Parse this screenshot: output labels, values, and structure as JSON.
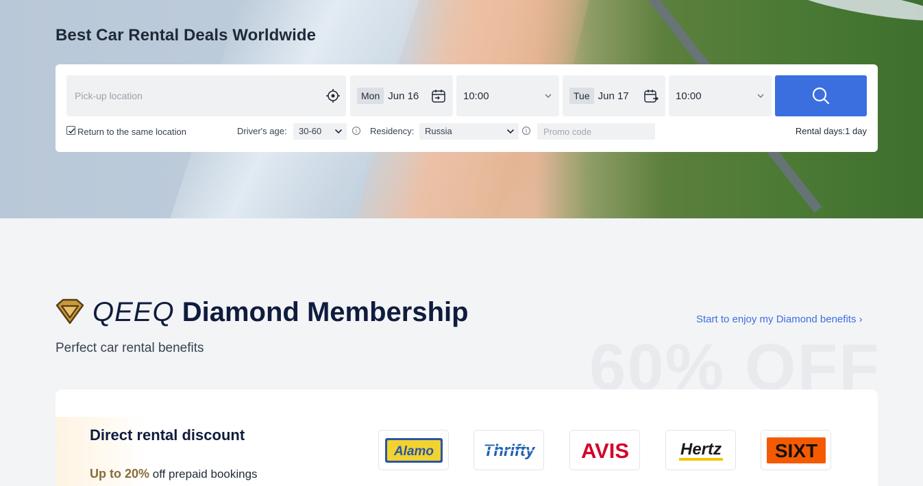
{
  "hero": {
    "title": "Best Car Rental Deals Worldwide"
  },
  "search": {
    "pickup_placeholder": "Pick-up location",
    "pickup_day": "Mon",
    "pickup_date": "Jun 16",
    "pickup_time": "10:00",
    "return_day": "Tue",
    "return_date": "Jun 17",
    "return_time": "10:00",
    "return_same_label": "Return to the same location",
    "return_same_checked": true,
    "age_label": "Driver's age:",
    "age_value": "30-60",
    "residency_label": "Residency:",
    "residency_value": "Russia",
    "promo_placeholder": "Promo code",
    "rental_days": "Rental days:1 day",
    "button_color": "#3b6fe0"
  },
  "membership": {
    "brand": "QEEQ",
    "title": "Diamond Membership",
    "subtitle": "Perfect car rental benefits",
    "link": "Start to enjoy my Diamond benefits",
    "watermark": "60% OFF",
    "card": {
      "title": "Direct rental discount",
      "highlight": "Up to 20%",
      "desc_rest": " off prepaid bookings",
      "logos": [
        "Alamo",
        "Thrifty",
        "AVIS",
        "Hertz",
        "SIXT"
      ]
    }
  }
}
